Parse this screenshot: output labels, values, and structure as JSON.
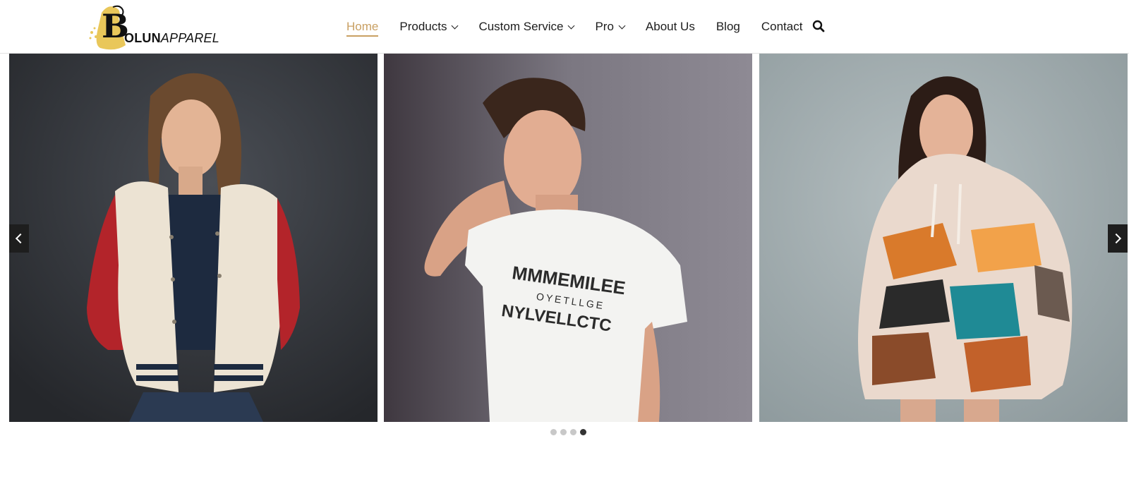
{
  "brand": {
    "initial": "B",
    "name_bold": "OLUN",
    "name_light": "APPAREL",
    "accent_color": "#c9a063"
  },
  "nav": {
    "items": [
      {
        "label": "Home",
        "active": true,
        "dropdown": false
      },
      {
        "label": "Products",
        "active": false,
        "dropdown": true
      },
      {
        "label": "Custom Service",
        "active": false,
        "dropdown": true
      },
      {
        "label": "Pro",
        "active": false,
        "dropdown": true
      },
      {
        "label": "About Us",
        "active": false,
        "dropdown": false
      },
      {
        "label": "Blog",
        "active": false,
        "dropdown": false
      },
      {
        "label": "Contact",
        "active": false,
        "dropdown": false
      }
    ],
    "search_icon": "search-icon"
  },
  "slider": {
    "slides": [
      {
        "subject": "woman in cream and red varsity jacket",
        "bg": "#3a3d42"
      },
      {
        "subject": "man in white graphic t-shirt",
        "bg": "#6d6a72",
        "shirt_text": [
          "MMMEMILEE",
          "OYETLLGE",
          "NYLVELLCTC"
        ]
      },
      {
        "subject": "woman in abstract print hoodie",
        "bg": "#a7b1b3"
      }
    ],
    "dot_count": 4,
    "active_dot": 3,
    "prev_icon": "chevron-left-icon",
    "next_icon": "chevron-right-icon"
  }
}
